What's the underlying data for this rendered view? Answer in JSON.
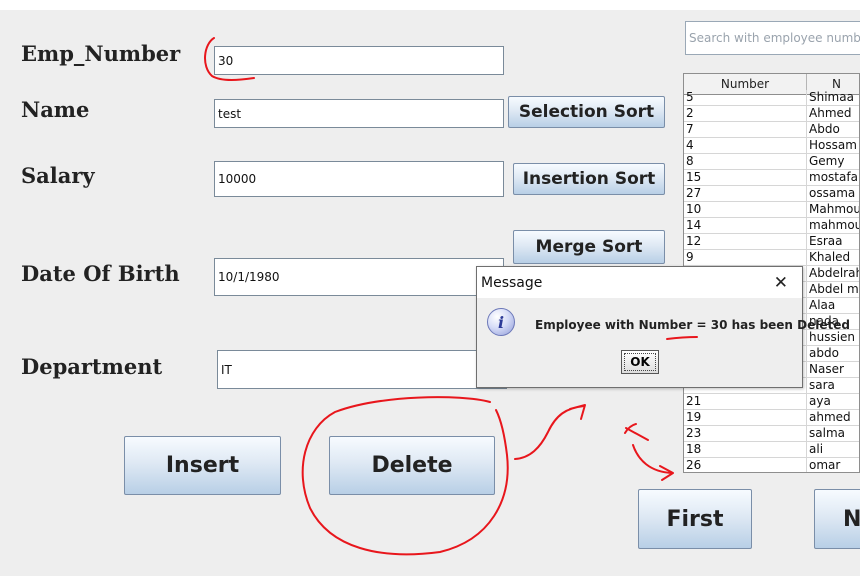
{
  "form": {
    "emp_number_label": "Emp_Number",
    "emp_number_value": "30",
    "name_label": "Name",
    "name_value": "test",
    "salary_label": "Salary",
    "salary_value": "10000",
    "dob_label": "Date Of Birth",
    "dob_value": "10/1/1980",
    "department_label": "Department",
    "department_value": "IT"
  },
  "search": {
    "placeholder": "Search with employee number ..."
  },
  "buttons": {
    "selection_sort": "Selection Sort",
    "insertion_sort": "Insertion Sort",
    "merge_sort": "Merge Sort",
    "insert": "Insert",
    "delete": "Delete",
    "first": "First",
    "next_partial": "N"
  },
  "table": {
    "columns": [
      "Number",
      "N"
    ],
    "rows": [
      [
        "5",
        "Shimaa"
      ],
      [
        "2",
        "Ahmed"
      ],
      [
        "7",
        "Abdo"
      ],
      [
        "4",
        "Hossam"
      ],
      [
        "8",
        "Gemy"
      ],
      [
        "15",
        "mostafa"
      ],
      [
        "27",
        "ossama"
      ],
      [
        "10",
        "Mahmoud"
      ],
      [
        "14",
        "mahmoud"
      ],
      [
        "12",
        "Esraa"
      ],
      [
        "9",
        "Khaled"
      ],
      [
        "",
        "Abdelrahman"
      ],
      [
        "",
        "Abdel mo"
      ],
      [
        "",
        "Alaa"
      ],
      [
        "",
        "nada"
      ],
      [
        "",
        "hussien"
      ],
      [
        "",
        "abdo"
      ],
      [
        "",
        "Naser"
      ],
      [
        "",
        "sara"
      ],
      [
        "21",
        "aya"
      ],
      [
        "19",
        "ahmed"
      ],
      [
        "23",
        "salma"
      ],
      [
        "18",
        "ali"
      ],
      [
        "26",
        "omar"
      ]
    ]
  },
  "dialog": {
    "title": "Message",
    "message": "Employee with Number = 30 has been Deleted",
    "ok": "OK",
    "info_icon_glyph": "i"
  },
  "colors": {
    "annotation": "#e8161c",
    "button_top": "#f7fbff",
    "button_bottom": "#b8cfe6"
  }
}
